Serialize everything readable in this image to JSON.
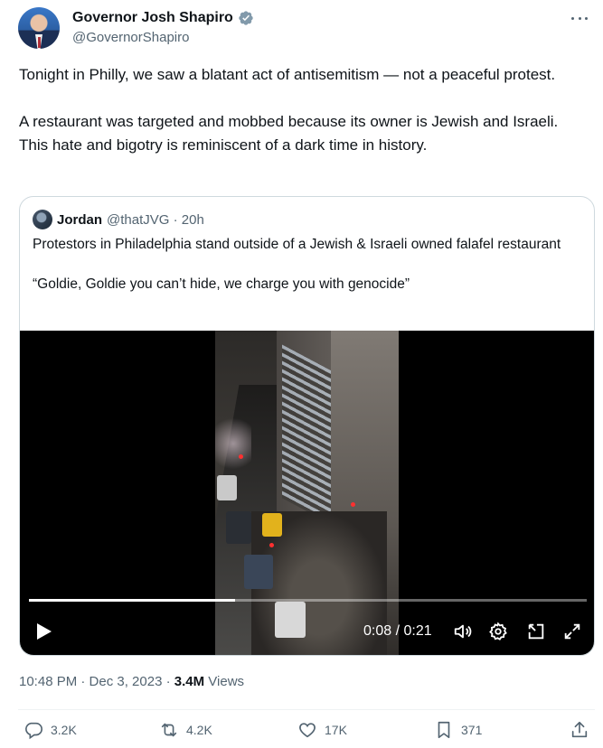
{
  "author": {
    "display_name": "Governor Josh Shapiro",
    "handle": "@GovernorShapiro",
    "verified_color": "#829aab"
  },
  "tweet": {
    "paragraph1": "Tonight in Philly, we saw a blatant act of antisemitism — not a peaceful protest.",
    "paragraph2": "A restaurant was targeted and mobbed because its owner is Jewish and Israeli. This hate and bigotry is reminiscent of a dark time in history."
  },
  "quote": {
    "name": "Jordan",
    "handle_time": "@thatJVG · 20h",
    "text1": "Protestors in Philadelphia stand outside of a Jewish & Israeli owned falafel restaurant",
    "text2": "“Goldie, Goldie you can’t hide, we charge you with genocide”",
    "video": {
      "time": "0:08 / 0:21",
      "progress_fraction": 0.37
    }
  },
  "meta": {
    "timestamp": "10:48 PM · Dec 3, 2023 · ",
    "views_count": "3.4M",
    "views_label": " Views"
  },
  "actions": {
    "replies": "3.2K",
    "reposts": "4.2K",
    "likes": "17K",
    "bookmarks": "371"
  },
  "icons": [
    "verified-badge-icon",
    "more-icon",
    "play-icon",
    "volume-icon",
    "settings-icon",
    "pip-icon",
    "fullscreen-icon",
    "reply-icon",
    "repost-icon",
    "like-icon",
    "bookmark-icon",
    "share-icon"
  ]
}
